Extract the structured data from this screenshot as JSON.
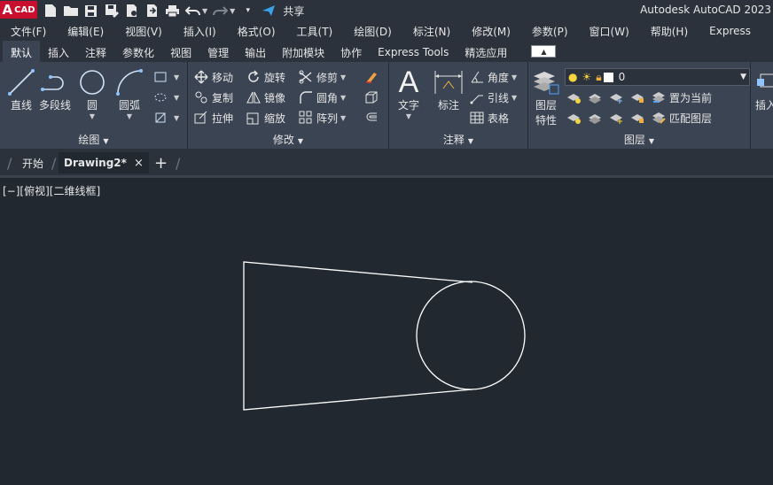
{
  "app": {
    "logo": {
      "letter": "A",
      "text": "CAD"
    },
    "title": "Autodesk AutoCAD 2023",
    "brand_color": "#c8102e"
  },
  "qat": {
    "share_label": "共享",
    "icons": [
      "new-file-icon",
      "open-folder-icon",
      "save-icon",
      "save-as-icon",
      "publish-icon",
      "export-icon",
      "print-icon",
      "undo-icon",
      "redo-icon",
      "customize-icon",
      "share-icon"
    ]
  },
  "menu": [
    "文件(F)",
    "编辑(E)",
    "视图(V)",
    "插入(I)",
    "格式(O)",
    "工具(T)",
    "绘图(D)",
    "标注(N)",
    "修改(M)",
    "参数(P)",
    "窗口(W)",
    "帮助(H)",
    "Express"
  ],
  "ribbon_tabs": [
    "默认",
    "插入",
    "注释",
    "参数化",
    "视图",
    "管理",
    "输出",
    "附加模块",
    "协作",
    "Express Tools",
    "精选应用"
  ],
  "active_ribbon_tab": "默认",
  "panels": {
    "draw": {
      "title": "绘图",
      "line": "直线",
      "polyline": "多段线",
      "circle": "圆",
      "arc": "圆弧"
    },
    "modify": {
      "title": "修改",
      "move": "移动",
      "rotate": "旋转",
      "trim": "修剪",
      "copy": "复制",
      "mirror": "镜像",
      "fillet": "圆角",
      "stretch": "拉伸",
      "scale": "缩放",
      "array": "阵列"
    },
    "annotation": {
      "title": "注释",
      "text": "文字",
      "dimension": "标注",
      "angular": "角度",
      "leader": "引线",
      "table": "表格"
    },
    "layers": {
      "title": "图层",
      "props_line1": "图层",
      "props_line2": "特性",
      "current_layer": "0",
      "set_current": "置为当前",
      "match_layer": "匹配图层"
    },
    "insert": {
      "label": "插入"
    }
  },
  "file_tabs": {
    "start": "开始",
    "drawing": "Drawing2*",
    "close": "×",
    "add": "+"
  },
  "viewport": {
    "label": "[−][俯视][二维线框]"
  },
  "colors": {
    "background": "#212830",
    "ribbon": "#3b4453",
    "chrome": "#2b323b",
    "geometry": "#ffffff"
  }
}
